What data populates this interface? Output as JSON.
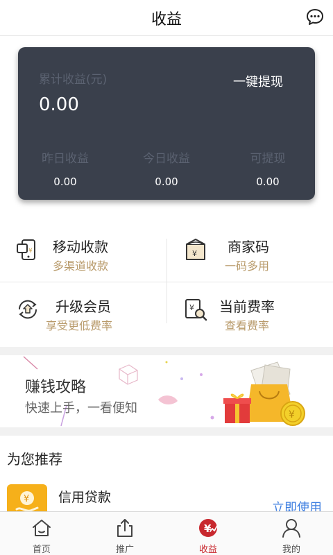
{
  "header": {
    "title": "收益",
    "message_icon": "chat-bubble-icon"
  },
  "card": {
    "total_label": "累计收益(元)",
    "total_value": "0.00",
    "withdraw_label": "一键提现",
    "stats": [
      {
        "label": "昨日收益",
        "value": "0.00"
      },
      {
        "label": "今日收益",
        "value": "0.00"
      },
      {
        "label": "可提现",
        "value": "0.00"
      }
    ],
    "background_color": "#3a404c"
  },
  "functions": [
    {
      "name": "移动收款",
      "sub": "多渠道收款",
      "icon": "mobile-payment-icon"
    },
    {
      "name": "商家码",
      "sub": "一码多用",
      "icon": "merchant-code-icon"
    },
    {
      "name": "升级会员",
      "sub": "享受更低费率",
      "icon": "upgrade-icon"
    },
    {
      "name": "当前费率",
      "sub": "查看费率",
      "icon": "rate-search-icon"
    }
  ],
  "accent_sub_color": "#b89a6a",
  "banner": {
    "title": "赚钱攻略",
    "subtitle": "快速上手，一看便知"
  },
  "recommend": {
    "title": "为您推荐",
    "items": [
      {
        "name": "信用贷款",
        "action": "立即使用",
        "icon": "yen-coin-icon"
      }
    ]
  },
  "tabs": [
    {
      "label": "首页",
      "icon": "home-icon",
      "active": false
    },
    {
      "label": "推广",
      "icon": "share-icon",
      "active": false
    },
    {
      "label": "收益",
      "icon": "earnings-icon",
      "active": true
    },
    {
      "label": "我的",
      "icon": "user-icon",
      "active": false
    }
  ],
  "active_color": "#c8282e",
  "link_color": "#3d7ee0"
}
